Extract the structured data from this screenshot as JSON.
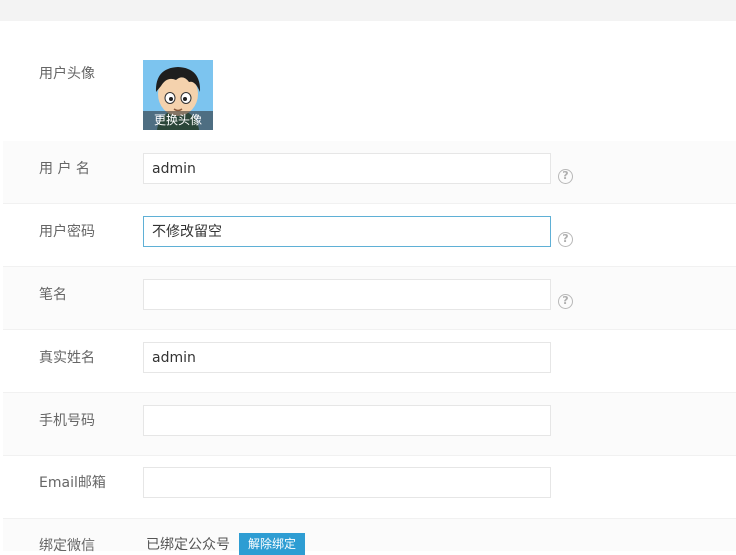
{
  "avatar": {
    "label": "用户头像",
    "caption": "更换头像"
  },
  "username": {
    "label": "用 户 名",
    "value": "admin",
    "help": "?"
  },
  "password": {
    "label": "用户密码",
    "placeholder": "不修改留空",
    "help": "?"
  },
  "penname": {
    "label": "笔名",
    "value": "",
    "help": "?"
  },
  "realname": {
    "label": "真实姓名",
    "value": "admin"
  },
  "phone": {
    "label": "手机号码",
    "value": ""
  },
  "email": {
    "label": "Email邮箱",
    "value": ""
  },
  "wechat": {
    "label": "绑定微信",
    "status": "已绑定公众号",
    "unbind_label": "解除绑定"
  },
  "colors": {
    "accent": "#2e9dd3",
    "focus_border": "#5fb0d6"
  }
}
